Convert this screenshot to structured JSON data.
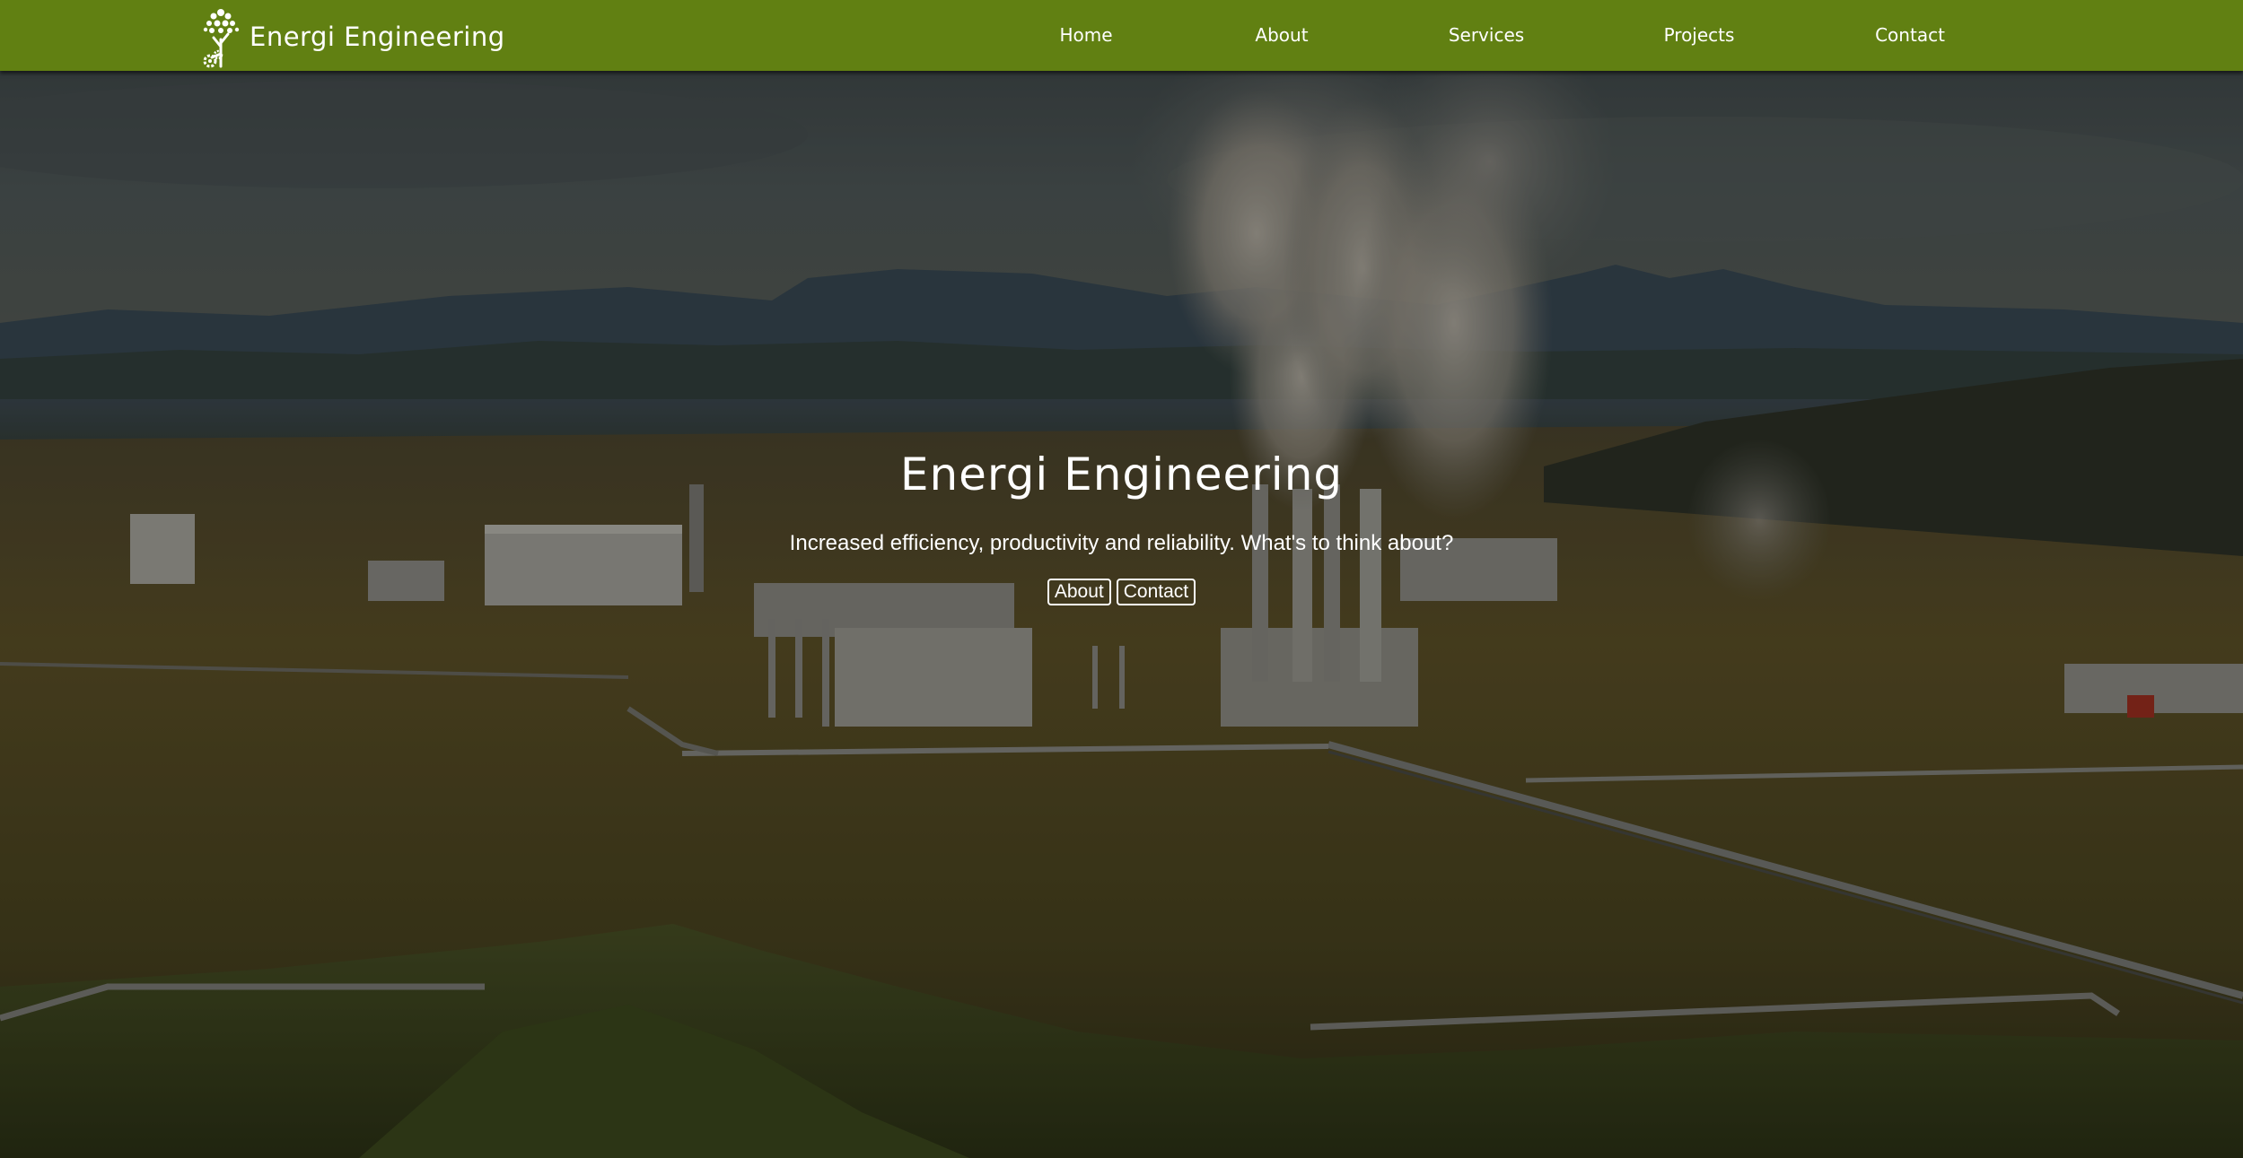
{
  "navbar": {
    "brand_name": "Energi Engineering",
    "logo_icon": "tree-gear-logo-icon",
    "background_color": "#618012",
    "links": [
      {
        "label": "Home"
      },
      {
        "label": "About"
      },
      {
        "label": "Services"
      },
      {
        "label": "Projects"
      },
      {
        "label": "Contact"
      }
    ]
  },
  "hero": {
    "background_image": "geothermal-power-plant-landscape",
    "title": "Energi Engineering",
    "tagline": "Increased efficiency, productivity and reliability. What's to think about?",
    "buttons": [
      {
        "label": "About"
      },
      {
        "label": "Contact"
      }
    ]
  }
}
